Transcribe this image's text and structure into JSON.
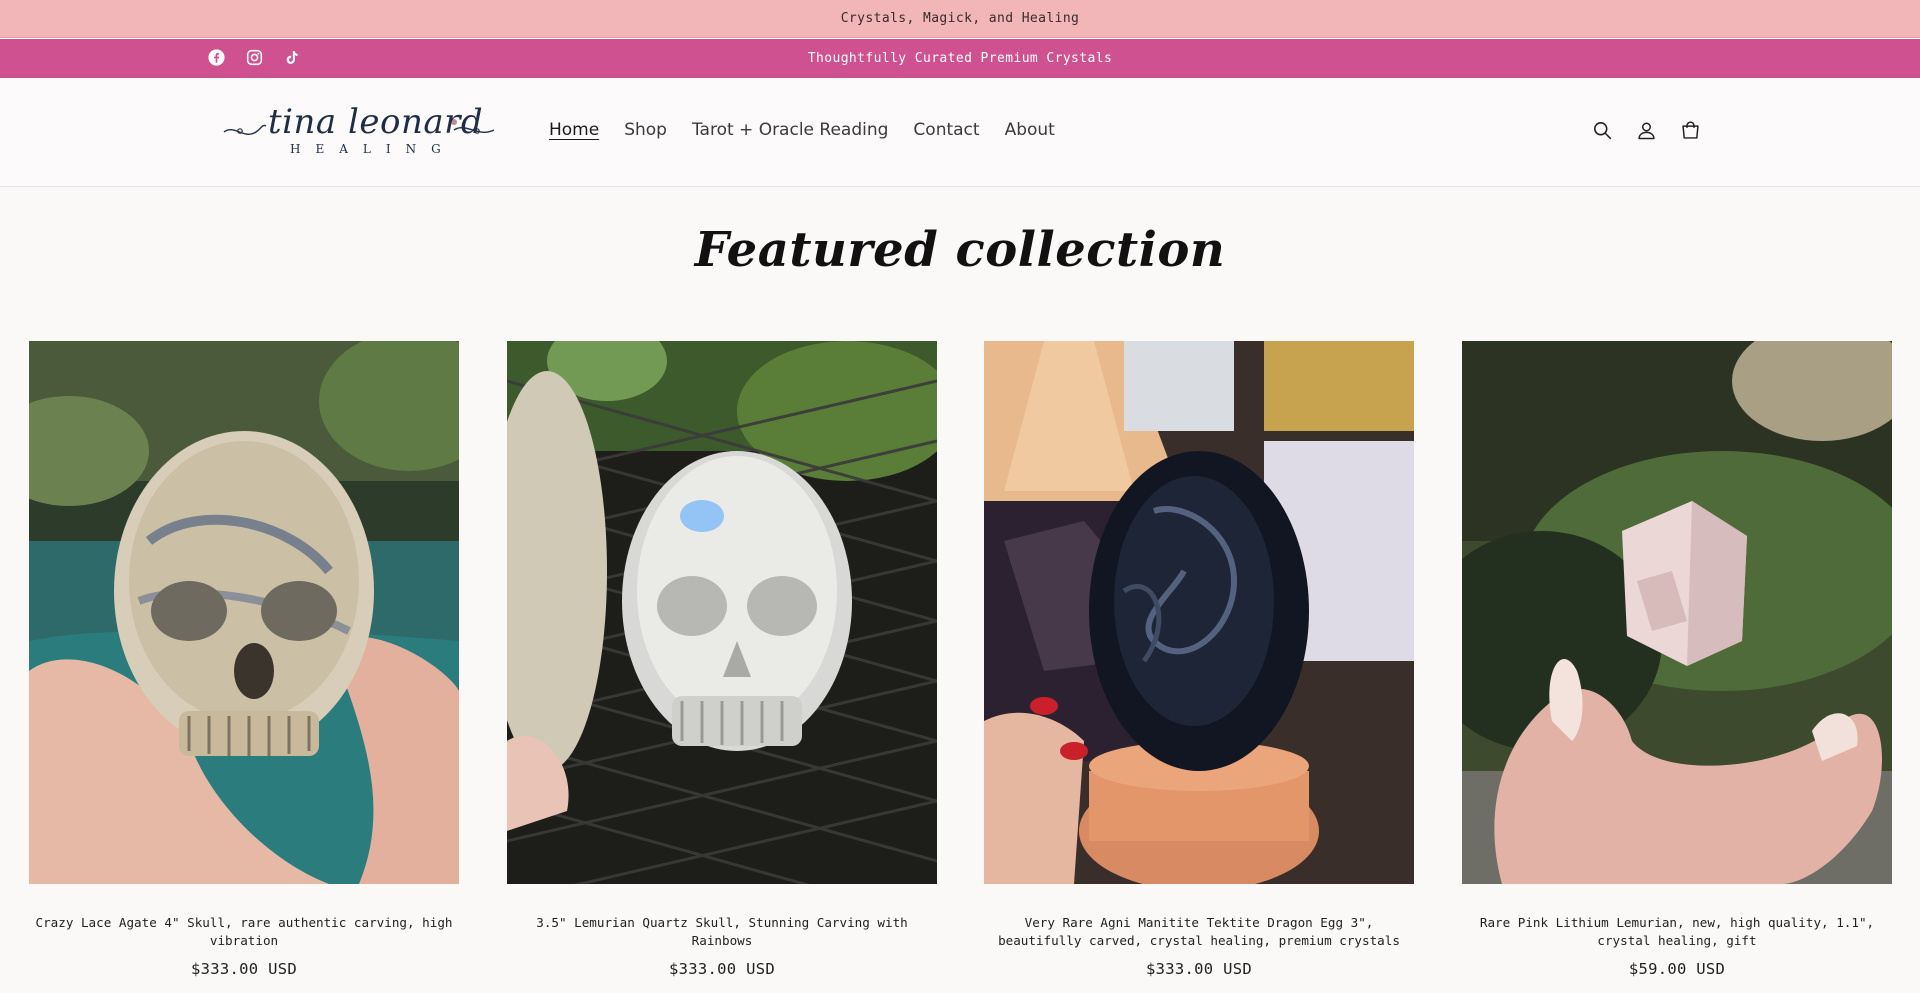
{
  "announcement": {
    "top_text": "Crystals, Magick, and Healing",
    "bar_text": "Thoughtfully Curated Premium Crystals",
    "bar_color": "#cf5190",
    "top_color": "#f2b6b8"
  },
  "social": {
    "icons": [
      "facebook-icon",
      "instagram-icon",
      "tiktok-icon"
    ]
  },
  "header": {
    "logo_script": "tina leonard",
    "logo_sub": "HEALING",
    "nav": [
      {
        "label": "Home",
        "active": true
      },
      {
        "label": "Shop"
      },
      {
        "label": "Tarot + Oracle Reading"
      },
      {
        "label": "Contact"
      },
      {
        "label": "About"
      }
    ],
    "icons": [
      "search-icon",
      "account-icon",
      "cart-icon"
    ]
  },
  "main": {
    "section_title": "Featured collection",
    "products": [
      {
        "name": "Crazy Lace Agate 4\" Skull, rare authentic carving, high vibration",
        "price": "$333.00 USD"
      },
      {
        "name": "3.5\" Lemurian Quartz Skull, Stunning Carving with Rainbows",
        "price": "$333.00 USD"
      },
      {
        "name": "Very Rare Agni Manitite Tektite Dragon Egg 3\", beautifully carved, crystal healing, premium crystals",
        "price": "$333.00 USD"
      },
      {
        "name": "Rare Pink Lithium Lemurian, new, high quality, 1.1\", crystal healing, gift",
        "price": "$59.00 USD"
      }
    ]
  }
}
